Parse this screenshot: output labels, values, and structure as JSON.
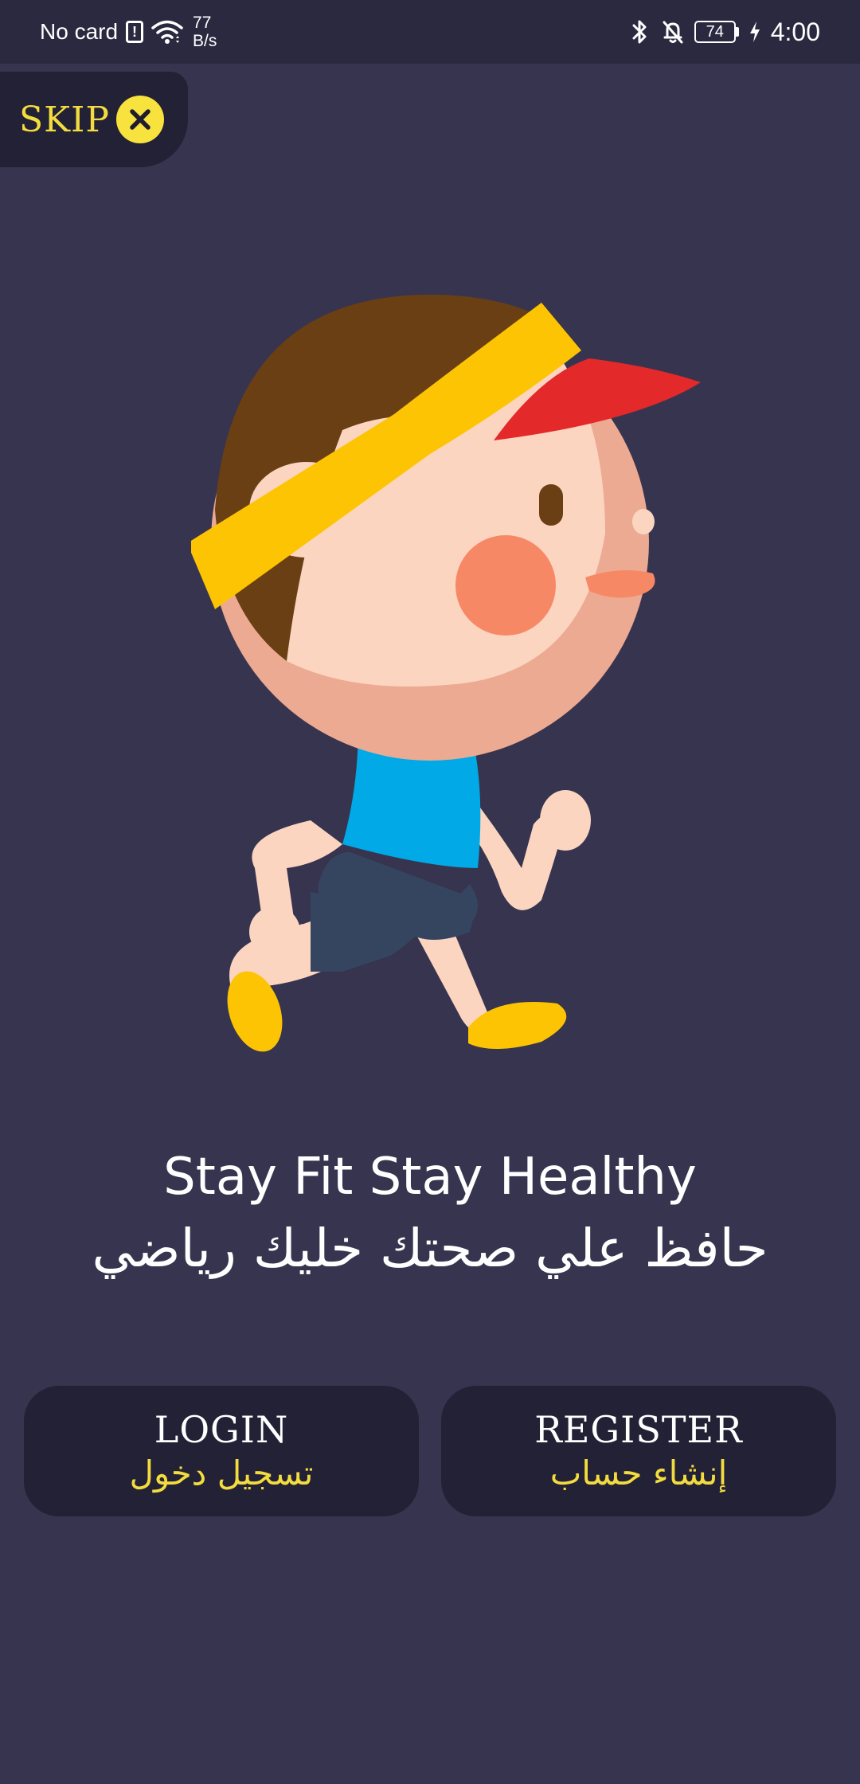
{
  "status_bar": {
    "carrier": "No card",
    "net_speed_value": "77",
    "net_speed_unit": "B/s",
    "battery_level": "74",
    "time": "4:00"
  },
  "skip": {
    "label": "SKIP"
  },
  "illustration": {
    "subject": "runner-illustration",
    "colors": {
      "hair": "#6a3f14",
      "skin": "#fcd5c1",
      "headband": "#fdc403",
      "cap_visor": "#e32929",
      "cheek": "#f78866",
      "shirt": "#01a9e6",
      "shorts": "#36455f",
      "shoes": "#fdc403"
    }
  },
  "headline": {
    "english": "Stay Fit Stay Healthy",
    "arabic": "حافظ علي صحتك خليك رياضي"
  },
  "buttons": {
    "login": {
      "label_en": "LOGIN",
      "label_ar": "تسجيل دخول"
    },
    "register": {
      "label_en": "REGISTER",
      "label_ar": "إنشاء حساب"
    }
  },
  "theme": {
    "background": "#37344f",
    "status_bar_bg": "#2b2940",
    "button_bg": "#232136",
    "accent_yellow": "#f3dc3f"
  }
}
